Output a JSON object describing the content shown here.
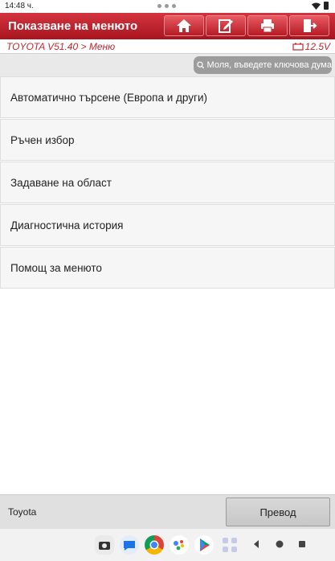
{
  "status": {
    "time": "14:48 ч."
  },
  "header": {
    "title": "Показване на менюто"
  },
  "breadcrumb": {
    "path": "TOYOTA V51.40 > Меню",
    "voltage": "12.5V"
  },
  "search": {
    "placeholder": "Моля, въведете ключова дума"
  },
  "menu": {
    "items": [
      {
        "label": "Автоматично търсене (Европа и други)"
      },
      {
        "label": "Ръчен избор"
      },
      {
        "label": "Задаване на област"
      },
      {
        "label": "Диагностична история"
      },
      {
        "label": "Помощ за менюто"
      }
    ]
  },
  "footer": {
    "vehicle": "Toyota",
    "translate_label": "Превод"
  },
  "colors": {
    "accent": "#c0272f",
    "header": "#b51b25"
  }
}
